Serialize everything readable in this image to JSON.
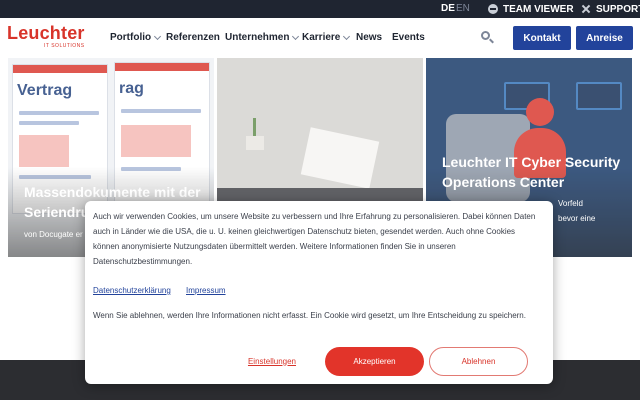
{
  "topbar": {
    "lang_active": "DE",
    "lang_other": "EN",
    "teamviewer": "TEAM VIEWER",
    "support": "SUPPORT"
  },
  "header": {
    "logo_main": "Leuchter",
    "logo_sub": "IT SOLUTIONS",
    "nav": [
      {
        "label": "Portfolio",
        "dropdown": true
      },
      {
        "label": "Referenzen",
        "dropdown": false
      },
      {
        "label": "Unternehmen",
        "dropdown": true
      },
      {
        "label": "Karriere",
        "dropdown": true
      },
      {
        "label": "News",
        "dropdown": false
      },
      {
        "label": "Events",
        "dropdown": false
      }
    ],
    "contact_button": "Kontakt",
    "request_button": "Anreise"
  },
  "cards": [
    {
      "image_word_1": "Vertrag",
      "image_word_2": "rag",
      "title_line1": "Massendokumente mit der",
      "title_line2": "Seriendru",
      "text": "von Docugate er"
    },
    {
      "title_line1": "",
      "text": ""
    },
    {
      "title_line1": "Leuchter IT Cyber Security",
      "title_line2": "Operations Center",
      "text_line1": "Vorfeld",
      "text_line2": "bevor eine"
    }
  ],
  "cookie": {
    "text": "Auch wir verwenden Cookies, um unsere Website zu verbessern und Ihre Erfahrung zu personalisieren. Dabei können Daten auch in Länder wie die USA, die u. U. keinen gleichwertigen Datenschutz bieten, gesendet werden. Auch ohne Cookies können anonymisierte Nutzungsdaten übermittelt werden. Weitere Informationen finden Sie in unseren Datenschutzbestimmungen.",
    "link_privacy": "Datenschutzerklärung",
    "link_imprint": "Impressum",
    "text2": "Wenn Sie ablehnen, werden Ihre Informationen nicht erfasst. Ein Cookie wird gesetzt, um Ihre Entscheidung zu speichern.",
    "settings_button": "Einstellungen",
    "accept_button": "Akzeptieren",
    "decline_button": "Ablehnen"
  },
  "colors": {
    "brand_red": "#d8342a",
    "brand_blue": "#22439b",
    "topbar": "#1f2531"
  },
  "icons": [
    "teamviewer-icon",
    "support-tools-icon",
    "search-icon",
    "chevron-down-icon"
  ]
}
